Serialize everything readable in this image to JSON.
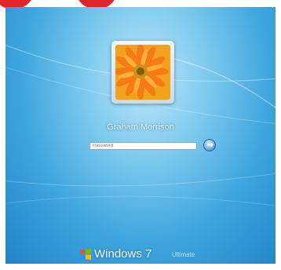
{
  "user": {
    "name": "Graham Morrison"
  },
  "password": {
    "value": "",
    "placeholder": "Password"
  },
  "submit": {
    "icon": "arrow-right-icon",
    "glyph": "➜"
  },
  "branding": {
    "product": "Windows",
    "version": "7",
    "edition": "Ultimate"
  },
  "colors": {
    "background": "#4fb2e6",
    "accent": "#e0242a",
    "text": "#eaf6fd"
  }
}
